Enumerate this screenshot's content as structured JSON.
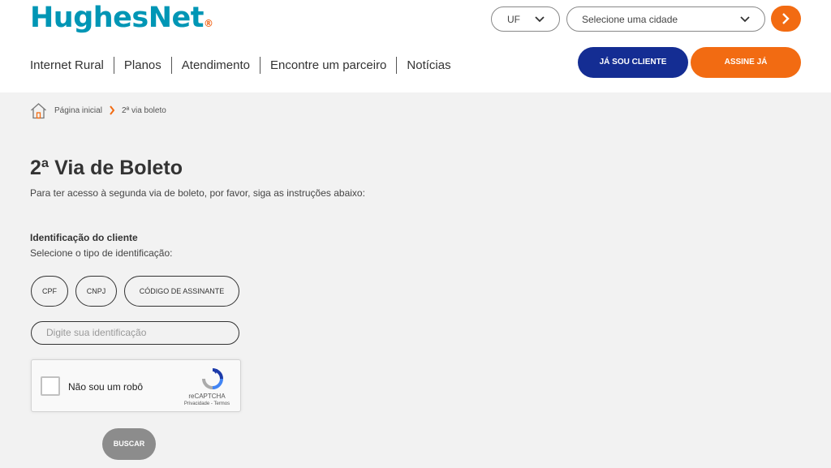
{
  "brand": {
    "logo_text": "HughesNet",
    "logo_dot": "®",
    "accent_color": "#0096b5",
    "orange": "#f26b12",
    "navy": "#142d93"
  },
  "location": {
    "uf_label": "UF",
    "city_placeholder": "Selecione uma cidade",
    "go_icon": "chevron-right-icon"
  },
  "nav": {
    "items": [
      "Internet Rural",
      "Planos",
      "Atendimento",
      "Encontre um parceiro",
      "Notícias"
    ]
  },
  "cta": {
    "cliente_label": "JÁ SOU CLIENTE",
    "assine_label": "ASSINE JÁ"
  },
  "breadcrumb": {
    "home_icon": "home-icon",
    "home_label": "Página inicial",
    "current": "2ª via boleto"
  },
  "page": {
    "title": "2ª Via de Boleto",
    "subtitle": "Para ter acesso à segunda via de boleto, por favor, siga as instruções abaixo:"
  },
  "identification": {
    "heading": "Identificação do cliente",
    "instruction": "Selecione o tipo de identificação:",
    "types": [
      "CPF",
      "CNPJ",
      "CÓDIGO DE ASSINANTE"
    ],
    "input_placeholder": "Digite sua identificação"
  },
  "captcha": {
    "label": "Não sou um robô",
    "brand": "reCAPTCHA",
    "links": "Privacidade - Termos"
  },
  "submit": {
    "label": "BUSCAR"
  }
}
